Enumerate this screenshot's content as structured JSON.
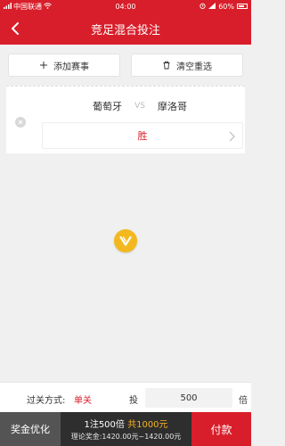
{
  "status": {
    "carrier": "中国联通",
    "time": "04:00",
    "battery": "60%"
  },
  "nav": {
    "title": "竞足混合投注"
  },
  "actions": {
    "add_match": "添加赛事",
    "clear_selection": "清空重选"
  },
  "ticket": {
    "home_team": "葡萄牙",
    "vs": "VS",
    "away_team": "摩洛哥",
    "pick": "胜"
  },
  "pass": {
    "label": "过关方式:",
    "value": "单关",
    "bet_prefix": "投",
    "multiplier": "500",
    "bet_suffix": "倍"
  },
  "bottom": {
    "optimize": "奖金优化",
    "summary_prefix": "1注500倍",
    "summary_total": "共1000元",
    "theory_prize": "理论奖金:1420.00元~1420.00元",
    "pay": "付款"
  },
  "colors": {
    "brand": "#d81e2a",
    "accent": "#f5b120"
  }
}
